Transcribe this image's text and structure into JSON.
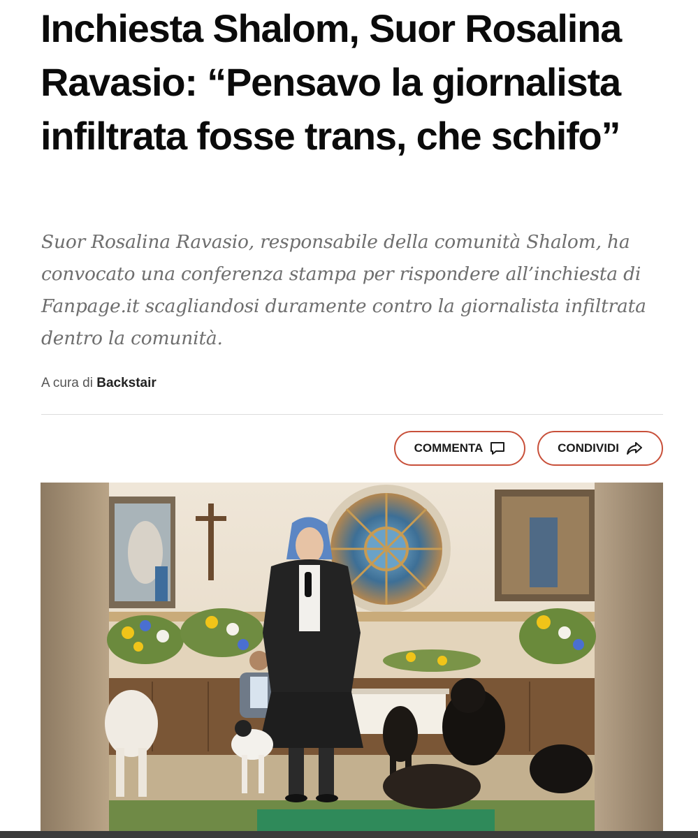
{
  "article": {
    "headline": "Inchiesta Shalom, Suor Rosalina Ravasio: “Pensavo la giornalista infiltrata fosse trans, che schifo”",
    "summary": "Suor Rosalina Ravasio, responsabile della comunità Shalom, ha convocato una conferenza stampa per rispondere all’inchiesta di Fanpage.it scagliandosi duramente contro la giornalista infiltrata dentro la comunità.",
    "byline_prefix": "A cura di",
    "author": "Backstair"
  },
  "actions": {
    "comment_label": "COMMENTA",
    "share_label": "CONDIVIDI",
    "comment_icon": "speech-bubble-icon",
    "share_icon": "share-arrow-icon",
    "accent_color": "#c8503a"
  }
}
